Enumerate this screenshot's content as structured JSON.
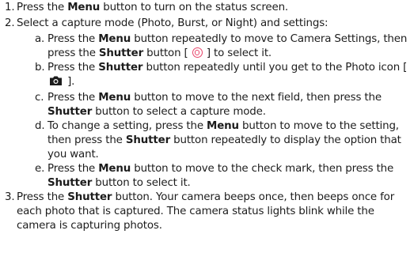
{
  "steps": [
    {
      "number": "1.",
      "segments": [
        {
          "t": "Press the ",
          "b": false
        },
        {
          "t": "Menu",
          "b": true
        },
        {
          "t": " button to turn on the status screen.",
          "b": false
        }
      ]
    },
    {
      "number": "2.",
      "segments": [
        {
          "t": "Select a capture mode (Photo, Burst, or Night) and settings:",
          "b": false
        }
      ],
      "substeps": [
        {
          "letter": "a.",
          "segments": [
            {
              "t": "Press the ",
              "b": false
            },
            {
              "t": "Menu",
              "b": true
            },
            {
              "t": " button repeatedly to move to Camera Settings, then press the ",
              "b": false
            },
            {
              "t": "Shutter",
              "b": true
            },
            {
              "t": " button [ ",
              "b": false
            },
            {
              "icon": "shutter-icon"
            },
            {
              "t": " ] to select it.",
              "b": false
            }
          ]
        },
        {
          "letter": "b.",
          "segments": [
            {
              "t": "Press the ",
              "b": false
            },
            {
              "t": "Shutter",
              "b": true
            },
            {
              "t": " button repeatedly until you get to the Photo icon [ ",
              "b": false
            },
            {
              "icon": "camera-icon"
            },
            {
              "t": " ].",
              "b": false
            }
          ]
        },
        {
          "letter": "c.",
          "segments": [
            {
              "t": "Press the ",
              "b": false
            },
            {
              "t": "Menu",
              "b": true
            },
            {
              "t": " button to move to the next field, then press the ",
              "b": false
            },
            {
              "t": "Shutter",
              "b": true
            },
            {
              "t": " button to select a capture mode.",
              "b": false
            }
          ]
        },
        {
          "letter": "d.",
          "segments": [
            {
              "t": "To change a setting, press the ",
              "b": false
            },
            {
              "t": "Menu",
              "b": true
            },
            {
              "t": " button to move to the setting, then press the ",
              "b": false
            },
            {
              "t": "Shutter",
              "b": true
            },
            {
              "t": " button repeatedly to display the option that you want.",
              "b": false
            }
          ]
        },
        {
          "letter": "e.",
          "segments": [
            {
              "t": "Press the ",
              "b": false
            },
            {
              "t": "Menu",
              "b": true
            },
            {
              "t": " button to move to the check mark, then press the ",
              "b": false
            },
            {
              "t": "Shutter",
              "b": true
            },
            {
              "t": " button to select it.",
              "b": false
            }
          ]
        }
      ]
    },
    {
      "number": "3.",
      "segments": [
        {
          "t": "Press the ",
          "b": false
        },
        {
          "t": "Shutter",
          "b": true
        },
        {
          "t": " button. Your camera beeps once, then beeps once for each photo that is captured. The camera status lights blink while the camera is capturing photos.",
          "b": false
        }
      ]
    }
  ],
  "icons": {
    "shutter_color": "#e8456b",
    "camera_color": "#1c1c1c"
  }
}
